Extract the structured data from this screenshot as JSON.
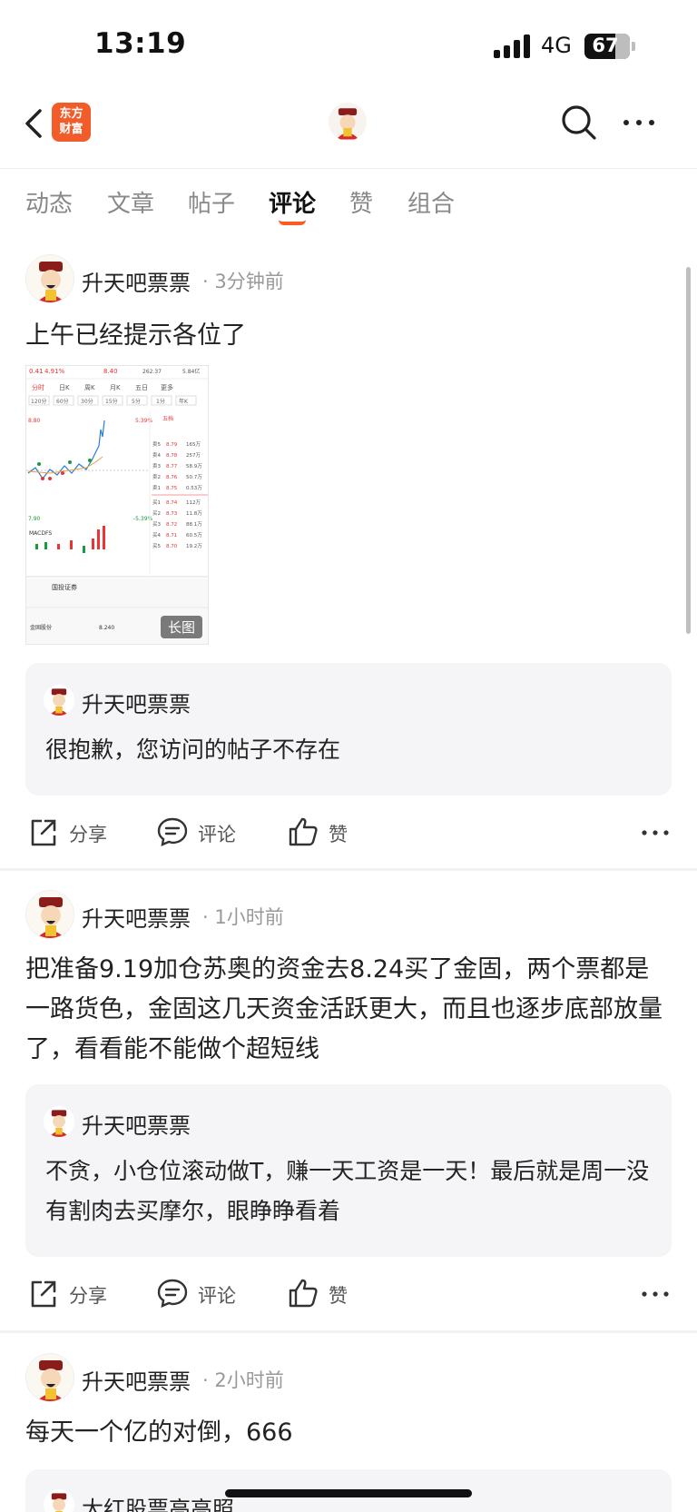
{
  "status_bar": {
    "time": "13:19",
    "network": "4G",
    "battery": "67"
  },
  "nav": {
    "logo_text": "东方财富",
    "logo_line1": "东方",
    "logo_line2": "财富"
  },
  "tabs": [
    {
      "label": "动态",
      "active": false
    },
    {
      "label": "文章",
      "active": false
    },
    {
      "label": "帖子",
      "active": false
    },
    {
      "label": "评论",
      "active": true
    },
    {
      "label": "赞",
      "active": false
    },
    {
      "label": "组合",
      "active": false
    }
  ],
  "posts": [
    {
      "author": "升天吧票票",
      "time_ago": "· 3分钟前",
      "text": "上午已经提示各位了",
      "image_badge": "长图",
      "quote": {
        "author": "升天吧票票",
        "text": "很抱歉，您访问的帖子不存在"
      },
      "actions": {
        "share": "分享",
        "comment": "评论",
        "like": "赞"
      }
    },
    {
      "author": "升天吧票票",
      "time_ago": "· 1小时前",
      "text": "把准备9.19加仓苏奥的资金去8.24买了金固，两个票都是一路货色，金固这几天资金活跃更大，而且也逐步底部放量了，看看能不能做个超短线",
      "quote": {
        "author": "升天吧票票",
        "text": "不贪，小仓位滚动做T，赚一天工资是一天！最后就是周一没有割肉去买摩尔，眼睁睁看着"
      },
      "actions": {
        "share": "分享",
        "comment": "评论",
        "like": "赞"
      }
    },
    {
      "author": "升天吧票票",
      "time_ago": "· 2小时前",
      "text": "每天一个亿的对倒，666",
      "quote": {
        "author": "大红股票高高照"
      }
    }
  ],
  "chart_thumb": {
    "header": {
      "price": "0.41",
      "pct": "4.91%",
      "last": "8.40",
      "pe": "262.37",
      "amount": "5.84亿"
    },
    "period_tabs": [
      "分时",
      "日K",
      "周K",
      "月K",
      "五日",
      "更多"
    ],
    "minute_tabs": [
      "120分",
      "60分",
      "30分",
      "15分",
      "5分",
      "1分",
      "年K"
    ],
    "price_top": "8.80",
    "price_bottom": "7.90",
    "pct_top": "5.39%",
    "pct_bottom": "-5.39%",
    "order_book": {
      "title": "五档",
      "asks": [
        {
          "name": "卖5",
          "price": "8.79",
          "vol": "165万"
        },
        {
          "name": "卖4",
          "price": "8.78",
          "vol": "257万"
        },
        {
          "name": "卖3",
          "price": "8.77",
          "vol": "58.9万"
        },
        {
          "name": "卖2",
          "price": "8.76",
          "vol": "50.7万"
        },
        {
          "name": "卖1",
          "price": "8.75",
          "vol": "0.53万"
        }
      ],
      "bids": [
        {
          "name": "买1",
          "price": "8.74",
          "vol": "112万"
        },
        {
          "name": "买2",
          "price": "8.73",
          "vol": "11.8万"
        },
        {
          "name": "买3",
          "price": "8.72",
          "vol": "88.1万"
        },
        {
          "name": "买4",
          "price": "8.71",
          "vol": "60.5万"
        },
        {
          "name": "买5",
          "price": "8.70",
          "vol": "19.2万"
        }
      ]
    },
    "indicator": "MACDFS",
    "broker": "国投证券",
    "bottom_row": {
      "name": "金固股份",
      "price": "8.240"
    }
  }
}
